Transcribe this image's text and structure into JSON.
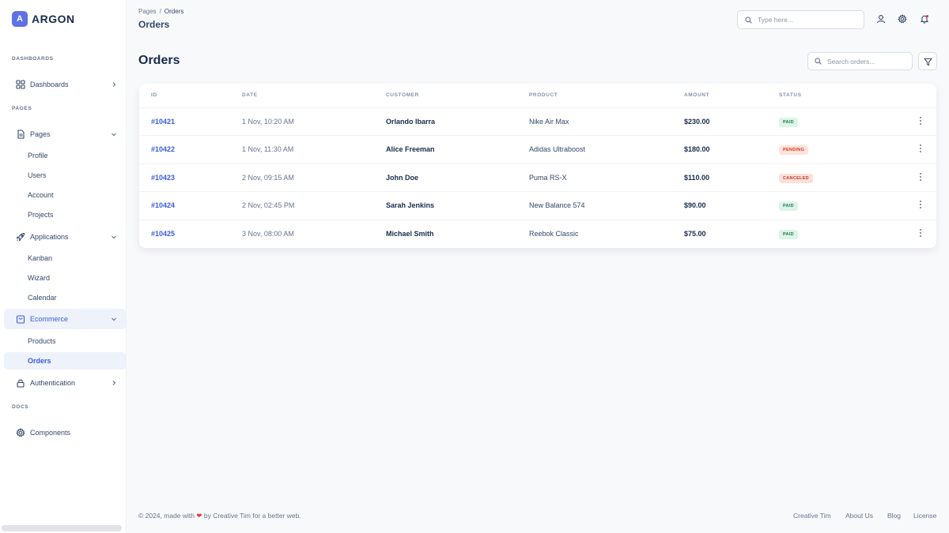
{
  "brand": {
    "logo_letter": "A",
    "name": "ARGON"
  },
  "sidebar": {
    "sections": {
      "dashboards": "DASHBOARDS",
      "pages": "PAGES",
      "docs": "DOCS"
    },
    "dashboards": "Dashboards",
    "pages": "Pages",
    "pages_sub": [
      "Profile",
      "Users",
      "Account",
      "Projects"
    ],
    "applications": "Applications",
    "applications_sub": [
      "Kanban",
      "Wizard",
      "Calendar"
    ],
    "ecommerce": "Ecommerce",
    "ecommerce_sub": [
      "Products",
      "Orders"
    ],
    "authentication": "Authentication",
    "components": "Components"
  },
  "header": {
    "breadcrumb": [
      "Pages",
      "/",
      "Orders"
    ],
    "title": "Orders",
    "search_placeholder": "Type here..."
  },
  "main": {
    "title": "Orders",
    "search_placeholder": "Search orders...",
    "columns": [
      "ID",
      "DATE",
      "CUSTOMER",
      "PRODUCT",
      "AMOUNT",
      "STATUS"
    ],
    "orders": [
      {
        "id": "#10421",
        "date": "1 Nov, 10:20 AM",
        "customer": "Orlando Ibarra",
        "product": "Nike Air Max",
        "amount": "$230.00",
        "status": "PAID"
      },
      {
        "id": "#10422",
        "date": "1 Nov, 11:30 AM",
        "customer": "Alice Freeman",
        "product": "Adidas Ultraboost",
        "amount": "$180.00",
        "status": "PENDING"
      },
      {
        "id": "#10423",
        "date": "2 Nov, 09:15 AM",
        "customer": "John Doe",
        "product": "Puma RS-X",
        "amount": "$110.00",
        "status": "CANCELED"
      },
      {
        "id": "#10424",
        "date": "2 Nov, 02:45 PM",
        "customer": "Sarah Jenkins",
        "product": "New Balance 574",
        "amount": "$90.00",
        "status": "PAID"
      },
      {
        "id": "#10425",
        "date": "3 Nov, 08:00 AM",
        "customer": "Michael Smith",
        "product": "Reebok Classic",
        "amount": "$75.00",
        "status": "PAID"
      }
    ]
  },
  "footer": {
    "copyright_prefix": "© 2024, made with",
    "copyright_suffix": "by Creative Tim for a better web.",
    "links": [
      "Creative Tim",
      "About Us",
      "Blog",
      "License"
    ]
  },
  "colors": {
    "accent": "#3b5bdb",
    "brand": "#5e72e4",
    "paid": "#1f7a4d",
    "pending": "#d2391f",
    "canceled": "#c0392b"
  },
  "icons": {
    "dashboards": "grid-icon",
    "pages": "document-icon",
    "applications": "rocket-icon",
    "ecommerce": "bag-icon",
    "authentication": "lock-icon",
    "components": "gear-icon"
  }
}
